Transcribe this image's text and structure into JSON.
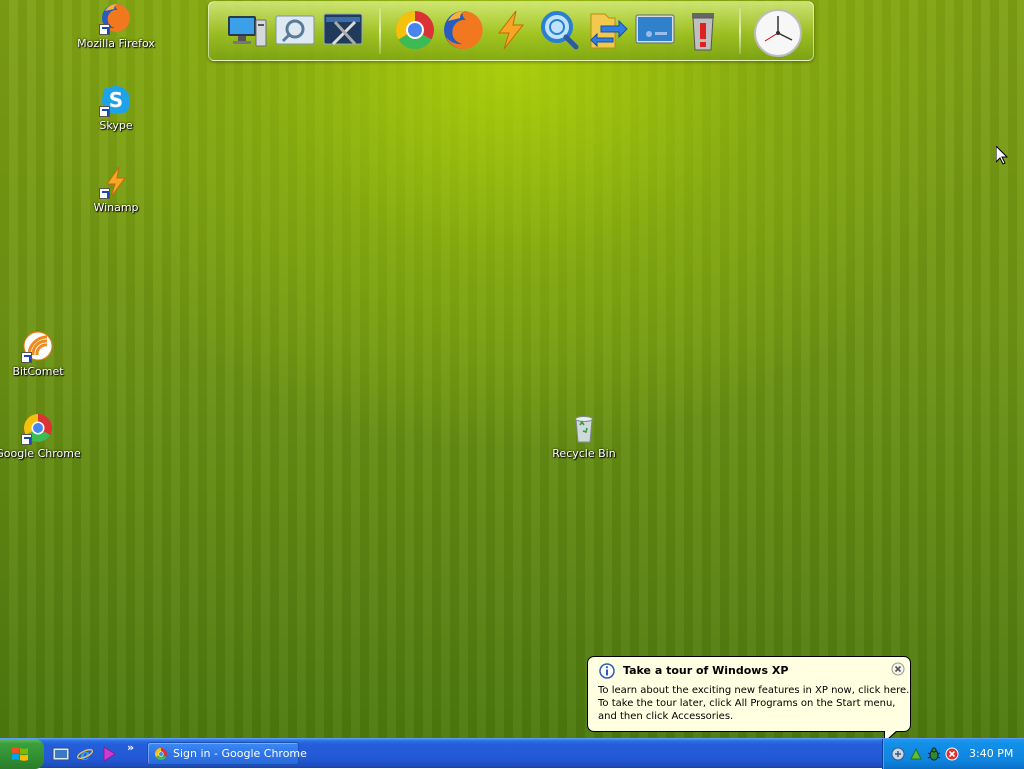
{
  "desktop": {
    "icons": [
      {
        "label": "Mozilla Firefox"
      },
      {
        "label": "Skype"
      },
      {
        "label": "Winamp"
      },
      {
        "label": "BitComet"
      },
      {
        "label": "Google Chrome"
      },
      {
        "label": "Recycle Bin"
      }
    ]
  },
  "dock": {
    "items": [
      "my-computer-icon",
      "search-window-icon",
      "settings-tools-icon",
      "chrome-icon",
      "firefox-icon",
      "winamp-bolt-icon",
      "magnifier-icon",
      "folder-arrow-icon",
      "monitor-icon",
      "trash-icon",
      "clock-icon"
    ]
  },
  "balloon": {
    "title": "Take a tour of Windows XP",
    "lines": [
      "To learn about the exciting new features in XP now, click here.",
      "To take the tour later, click All Programs on the Start menu,",
      "and then click Accessories."
    ]
  },
  "taskbar": {
    "quick_launch": [
      "show-desktop-icon",
      "internet-explorer-icon",
      "media-player-icon"
    ],
    "chevron": "»",
    "tasks": [
      {
        "label": "Sign in - Google Chrome"
      }
    ],
    "clock": "3:40 PM"
  },
  "colors": {
    "desktop_green": "#6f9414",
    "taskbar_blue": "#245edb",
    "start_green": "#3c9f3c",
    "tray_blue": "#0f85df",
    "balloon_bg": "#ffffe1"
  }
}
